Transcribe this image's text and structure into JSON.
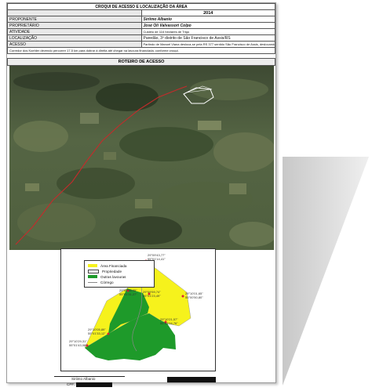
{
  "document": {
    "title": "CROQUI DE ACESSO E LOCALIZAÇÃO DA ÁREA",
    "year": "2014",
    "fields": [
      {
        "label": "PROPONENTE",
        "value": "Siriimo Albanio"
      },
      {
        "label": "PROPRIETÁRIO",
        "value": "José Oli Valvassori Colpo"
      },
      {
        "label": "ATIVIDADE",
        "value": "Custeio de 116 hectares de Trigo"
      },
      {
        "label": "LOCALIZAÇÃO",
        "value": "Paredão, 3º distrito de São Francisco de Assis/RS"
      },
      {
        "label": "ACESSO",
        "value": "Partindo de Manoel Viana desloca-se pela RS 377 sentido São Francisco de Assis, deslocando-se 2 km para seguir à esquerda pelo"
      }
    ],
    "access_continuation": "Corredor dos Koehler devendo percorrer 17,5 km para dobrar à direita até chegar na lavoura financiada, conforme croqui.",
    "section_title": "ROTEIRO DE ACESSO"
  },
  "map": {
    "legend": [
      {
        "label": "Área Financiada",
        "color": "#f6f21c"
      },
      {
        "label": "Propriedade",
        "color": "#ffffff"
      },
      {
        "label": "Outras lavouras",
        "color": "#1e9a2a"
      },
      {
        "label": "Córrego",
        "color": "#888888"
      }
    ],
    "coordinates": [
      {
        "lat": "29°09'43,77\"",
        "lon": "55°01'14,41\""
      },
      {
        "lat": "29°09'58,95\"",
        "lon": "55°01'31,27\""
      },
      {
        "lat": "29°09'59,74\"",
        "lon": "55°01'23,49\""
      },
      {
        "lat": "29°10'01,65\"",
        "lon": "55°00'50,80\""
      },
      {
        "lat": "29°10'21,57\"",
        "lon": "55°01'04,76\""
      },
      {
        "lat": "29°10'05,89\"",
        "lon": "55°01'33,12\""
      },
      {
        "lat": "29°10'29,31\"",
        "lon": "55°01'43,08\""
      }
    ]
  },
  "signature": {
    "name": "Siriimo Albanio",
    "cpf_label": "CPF:"
  }
}
